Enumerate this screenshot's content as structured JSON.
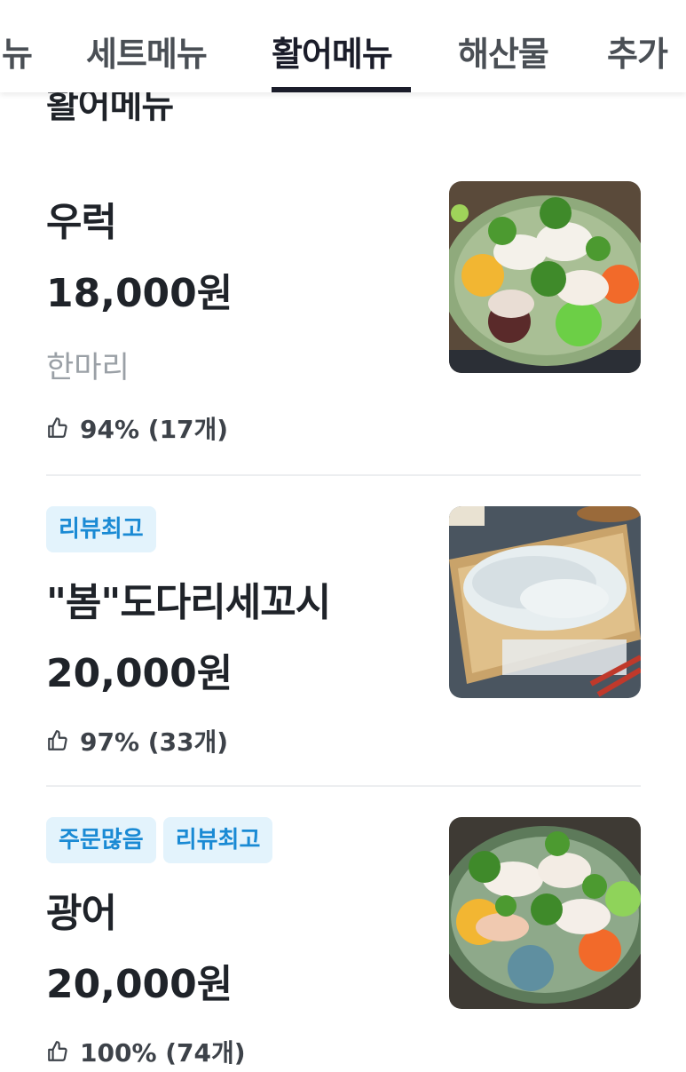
{
  "tabs": [
    {
      "label": "메뉴"
    },
    {
      "label": "세트메뉴"
    },
    {
      "label": "활어메뉴"
    },
    {
      "label": "해산물"
    },
    {
      "label": "추가"
    }
  ],
  "section": {
    "title": "활어메뉴"
  },
  "items": [
    {
      "name": "우럭",
      "price": "18,000원",
      "description": "한마리",
      "rating": "94% (17개)",
      "badges": [],
      "image_icon": "sashimi-platter-photo"
    },
    {
      "name": "\"봄\"도다리세꼬시",
      "price": "20,000원",
      "description": "",
      "rating": "97% (33개)",
      "badges": [
        "리뷰최고"
      ],
      "image_icon": "sliced-fish-photo"
    },
    {
      "name": "광어",
      "price": "20,000원",
      "description": "",
      "rating": "100% (74개)",
      "badges": [
        "주문많음",
        "리뷰최고"
      ],
      "image_icon": "flatfish-sashimi-photo"
    }
  ],
  "colors": {
    "badge_bg": "#e3f3fc",
    "badge_text": "#1a8ad4",
    "active_tab": "#1b1d2a"
  }
}
